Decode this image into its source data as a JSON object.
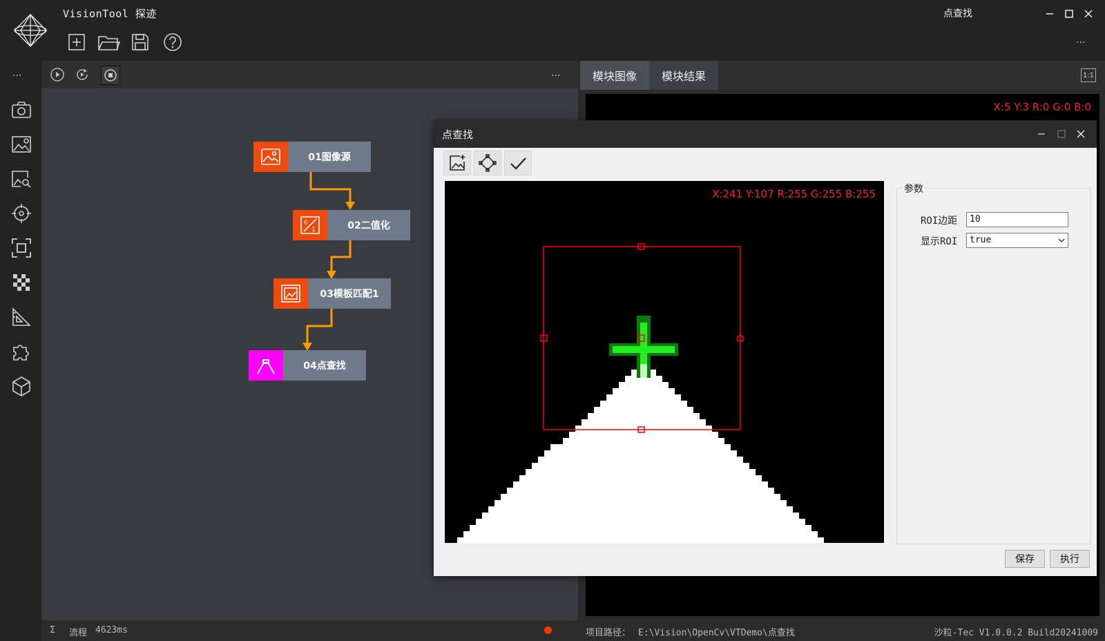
{
  "app": {
    "title": "VisionTool 探迹",
    "window_title": "点查找",
    "toolbar_icons": [
      "new-file-icon",
      "open-folder-icon",
      "save-icon",
      "help-icon"
    ],
    "more": "..."
  },
  "rail": {
    "more": "...",
    "icons": [
      "camera-icon",
      "image-settings-icon",
      "image-search-icon",
      "target-icon",
      "focus-icon",
      "grid-icon",
      "measure-icon",
      "puzzle-icon",
      "cube-icon"
    ]
  },
  "flow": {
    "toolbar_more": "...",
    "nodes": [
      {
        "label": "01图像源",
        "icon": "image-icon",
        "color": "#f04a0c"
      },
      {
        "label": "02二值化",
        "icon": "binary-icon",
        "color": "#f04a0c"
      },
      {
        "label": "03模板匹配1",
        "icon": "template-icon",
        "color": "#f04a0c"
      },
      {
        "label": "04点查找",
        "icon": "point-find-icon",
        "color": "#ff00ff"
      }
    ],
    "connector_color": "#ff9900",
    "status": {
      "sigma": "Σ",
      "label": "流程",
      "time": "4623ms",
      "dot_color": "#ff3300"
    }
  },
  "right": {
    "tabs": [
      "模块图像",
      "模块结果"
    ],
    "ratio_label": "1:1",
    "pixel_info": "X:5 Y:3  R:0 G:0 B:0",
    "path_label": "项目路径：",
    "path": "E:\\Vision\\OpenCv\\VTDemo\\点查找",
    "version": "沙粒-Tec V1.0.0.2 Build20241009"
  },
  "dialog": {
    "title": "点查找",
    "tools": [
      "add-image-icon",
      "roi-edit-icon",
      "check-icon"
    ],
    "pixel_info": "X:241 Y:107  R:255 G:255 B:255",
    "params_group": "参数",
    "params": {
      "roi_margin_label": "ROI边距",
      "roi_margin_value": "10",
      "show_roi_label": "显示ROI",
      "show_roi_value": "true"
    },
    "save_button": "保存",
    "run_button": "执行",
    "roi_color": "#ff0000",
    "marker_color": "#00ff00"
  }
}
